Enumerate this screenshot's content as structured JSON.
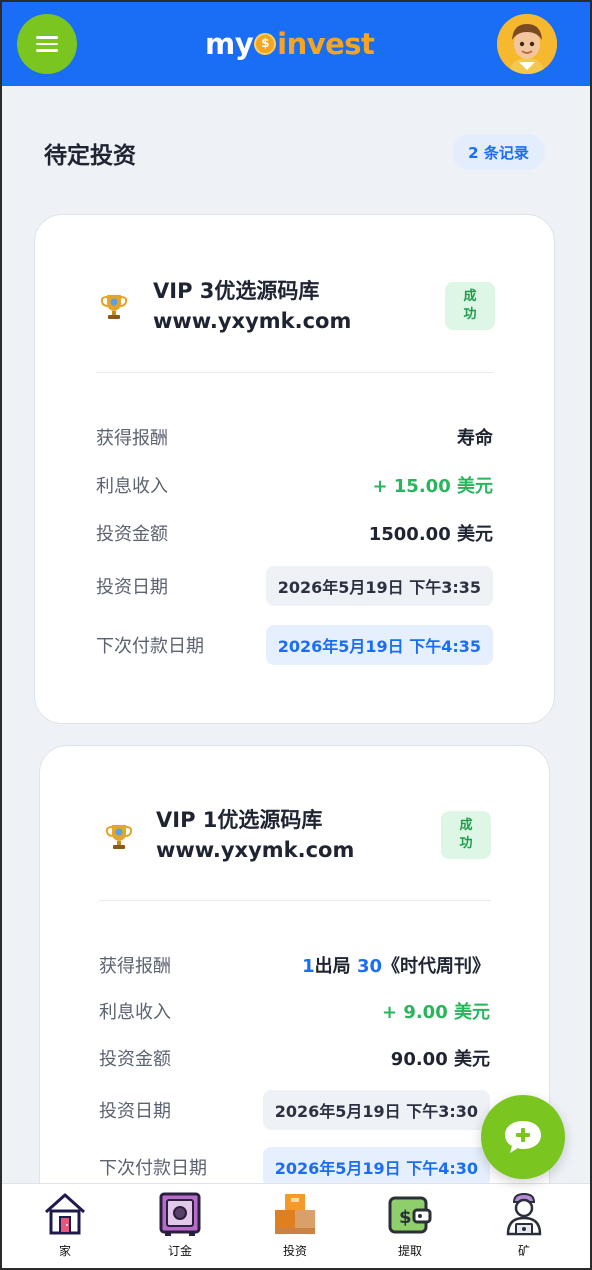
{
  "header": {
    "logo_part1": "my",
    "logo_part2": "invest",
    "brand_color": "#1a6ef5",
    "accent_color": "#7ac520"
  },
  "section": {
    "title": "待定投资",
    "record_count": "2 条记录"
  },
  "investments": [
    {
      "title_line1": "VIP 3优选源码库",
      "title_line2": "www.yxymk.com",
      "status": "成功",
      "rows": {
        "reward_label": "获得报酬",
        "reward_value": "寿命",
        "interest_label": "利息收入",
        "interest_value": "+ 15.00 美元",
        "amount_label": "投资金额",
        "amount_value": "1500.00 美元",
        "date_label": "投资日期",
        "date_value": "2026年5月19日 下午3:35",
        "next_label": "下次付款日期",
        "next_value": "2026年5月19日 下午4:35"
      }
    },
    {
      "title_line1": "VIP 1优选源码库",
      "title_line2": "www.yxymk.com",
      "status": "成功",
      "rows": {
        "reward_label": "获得报酬",
        "reward_num1": "1",
        "reward_text1": "出局",
        "reward_num2": "30",
        "reward_text2": "《时代周刊》",
        "interest_label": "利息收入",
        "interest_value": "+ 9.00 美元",
        "amount_label": "投资金额",
        "amount_value": "90.00 美元",
        "date_label": "投资日期",
        "date_value": "2026年5月19日 下午3:30",
        "next_label": "下次付款日期",
        "next_value": "2026年5月19日 下午4:30"
      }
    }
  ],
  "bottom_nav": [
    {
      "label": "家",
      "icon": "home-icon"
    },
    {
      "label": "订金",
      "icon": "safe-icon"
    },
    {
      "label": "投资",
      "icon": "boxes-icon"
    },
    {
      "label": "提取",
      "icon": "wallet-icon"
    },
    {
      "label": "矿",
      "icon": "miner-icon"
    }
  ]
}
